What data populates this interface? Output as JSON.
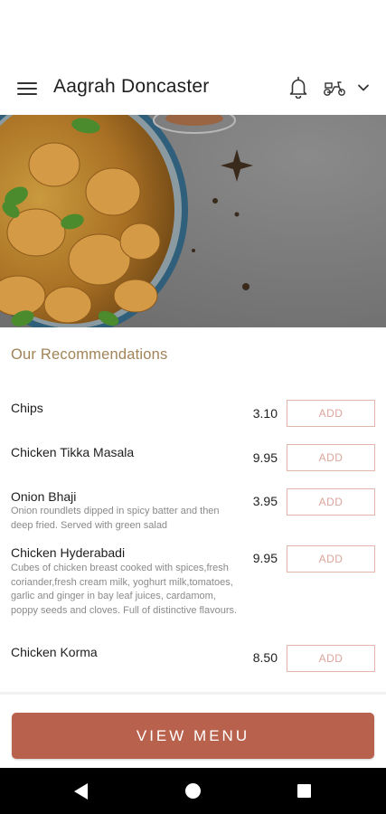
{
  "app": {
    "title": "Aagrah Doncaster",
    "icons": [
      "hamburger-menu-icon",
      "bell-icon",
      "scooter-icon",
      "chevron-down-icon"
    ]
  },
  "section": {
    "title": "Our Recommendations"
  },
  "items": [
    {
      "name": "Chips",
      "description": "",
      "price": "3.10",
      "add_label": "ADD"
    },
    {
      "name": "Chicken Tikka Masala",
      "description": "",
      "price": "9.95",
      "add_label": "ADD"
    },
    {
      "name": "Onion Bhaji",
      "description": "Onion roundlets dipped in spicy batter and then deep fried. Served with green salad",
      "price": "3.95",
      "add_label": "ADD"
    },
    {
      "name": "Chicken Hyderabadi",
      "description": "Cubes of chicken breast cooked with spices,fresh coriander,fresh cream milk, yoghurt milk,tomatoes, garlic and ginger in bay leaf juices, cardamom, poppy seeds and cloves. Full of distinctive flavours.",
      "price": "9.95",
      "add_label": "ADD"
    },
    {
      "name": "Chicken Korma",
      "description": "",
      "price": "8.50",
      "add_label": "ADD"
    }
  ],
  "footer": {
    "view_menu_label": "VIEW MENU"
  },
  "colors": {
    "accent": "#b8624e",
    "section_title": "#a08458",
    "add_border": "#e3b5ad",
    "add_text": "#dba59c"
  }
}
